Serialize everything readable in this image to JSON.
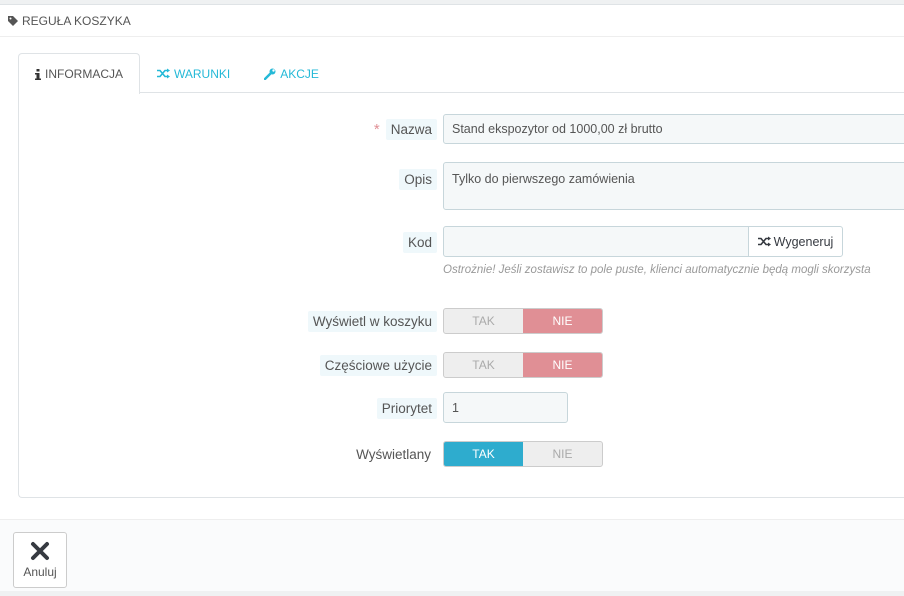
{
  "header": {
    "title": "REGUŁA KOSZYKA",
    "icon": "tag-icon"
  },
  "tabs": [
    {
      "label": "INFORMACJA",
      "icon": "info-icon",
      "active": true
    },
    {
      "label": "WARUNKI",
      "icon": "shuffle-icon",
      "active": false
    },
    {
      "label": "AKCJE",
      "icon": "wrench-icon",
      "active": false
    }
  ],
  "form": {
    "name": {
      "label": "Nazwa",
      "required_mark": "*",
      "value": "Stand ekspozytor od 1000,00 zł brutto"
    },
    "description": {
      "label": "Opis",
      "value": "Tylko do pierwszego zamówienia"
    },
    "code": {
      "label": "Kod",
      "value": "",
      "generate_label": "Wygeneruj",
      "help": "Ostrożnie! Jeśli zostawisz to pole puste, klienci automatycznie będą mogli skorzysta"
    },
    "show_in_cart": {
      "label": "Wyświetl w koszyku",
      "yes": "TAK",
      "no": "NIE",
      "selected": "NIE"
    },
    "partial_use": {
      "label": "Częściowe użycie",
      "yes": "TAK",
      "no": "NIE",
      "selected": "NIE"
    },
    "priority": {
      "label": "Priorytet",
      "value": "1"
    },
    "displayed": {
      "label": "Wyświetlany",
      "yes": "TAK",
      "no": "NIE",
      "selected": "TAK"
    }
  },
  "footer": {
    "cancel_label": "Anuluj",
    "cancel_icon": "close-icon"
  },
  "colors": {
    "accent": "#25b9d7",
    "switch_yes": "#2eacce",
    "switch_no": "#e08f95",
    "label_bg": "#eff8fb"
  }
}
